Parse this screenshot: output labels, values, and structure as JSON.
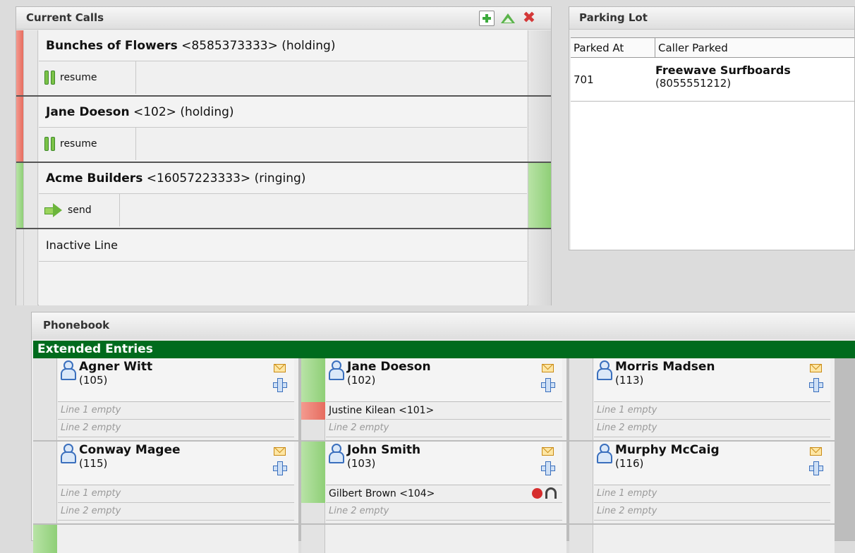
{
  "current_calls": {
    "title": "Current Calls",
    "lines": [
      {
        "name": "Bunches of Flowers",
        "detail": " <8585373333> (holding)",
        "state": "holding",
        "action": "resume"
      },
      {
        "name": "Jane Doeson",
        "detail": " <102> (holding)",
        "state": "holding",
        "action": "resume"
      },
      {
        "name": "Acme Builders",
        "detail": " <16057223333> (ringing)",
        "state": "ringing",
        "action": "send"
      }
    ],
    "inactive_label": "Inactive Line"
  },
  "parking_lot": {
    "title": "Parking Lot",
    "columns": [
      "Parked At",
      "Caller Parked"
    ],
    "rows": [
      {
        "parked_at": "701",
        "caller_name": "Freewave Surfboards",
        "caller_number": "(8055551212)"
      }
    ]
  },
  "phonebook": {
    "title": "Phonebook",
    "section": "Extended Entries",
    "entries": [
      {
        "name": "Agner Witt",
        "ext": "(105)",
        "line1": "Line 1 empty",
        "line2": "Line 2 empty"
      },
      {
        "name": "Jane Doeson",
        "ext": "(102)",
        "line1": "Justine Kilean <101>",
        "line2": "Line 2 empty"
      },
      {
        "name": "Morris Madsen",
        "ext": "(113)",
        "line1": "Line 1 empty",
        "line2": "Line 2 empty"
      },
      {
        "name": "Conway Magee",
        "ext": "(115)",
        "line1": "Line 1 empty",
        "line2": "Line 2 empty"
      },
      {
        "name": "John Smith",
        "ext": "(103)",
        "line1": "Gilbert Brown <104>",
        "line2": "Line 2 empty"
      },
      {
        "name": "Murphy McCaig",
        "ext": "(116)",
        "line1": "Line 1 empty",
        "line2": "Line 2 empty"
      }
    ]
  },
  "colors": {
    "holding": "#e66c5f",
    "ringing": "#8fcf77",
    "section_bar": "#006b1d"
  },
  "icons": [
    "add-line-icon",
    "collapse-up-icon",
    "close-icon",
    "pause-icon",
    "send-arrow-icon",
    "person-icon",
    "mail-icon",
    "add-plus-icon",
    "record-icon",
    "headset-icon"
  ]
}
